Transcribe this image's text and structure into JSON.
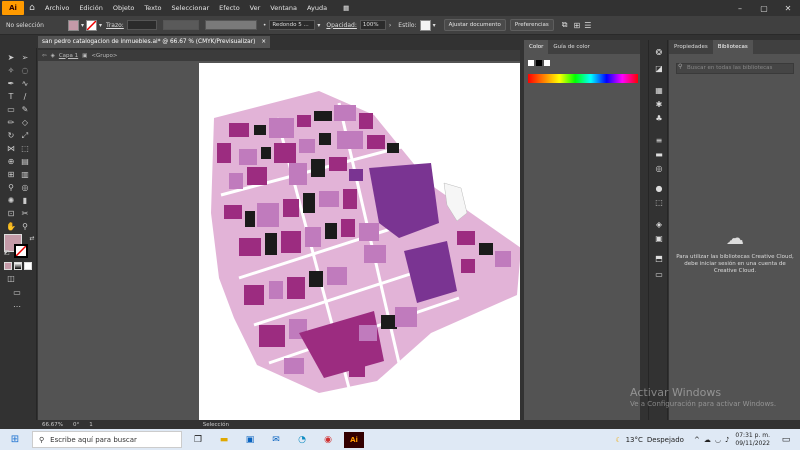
{
  "app": {
    "logo": "Ai",
    "menu": [
      "Archivo",
      "Edición",
      "Objeto",
      "Texto",
      "Seleccionar",
      "Efecto",
      "Ver",
      "Ventana",
      "Ayuda"
    ]
  },
  "control_bar": {
    "selection_label": "No selección",
    "stroke_label": "Trazo:",
    "brush": "Redondo 5 ...",
    "opacity_label": "Opacidad:",
    "opacity_value": "100%",
    "style_label": "Estilo:",
    "align_doc_button": "Ajustar documento",
    "prefs_button": "Preferencias"
  },
  "document": {
    "tab_title": "san pedro catalogacion de inmuebles.ai* @ 66.67 % (CMYK/Previsualizar)",
    "close_icon": "×",
    "breadcrumb_layer": "Capa 1",
    "breadcrumb_group": "<Grupo>"
  },
  "panels": {
    "color_tab": "Color",
    "color_guide_tab": "Guía de color",
    "properties_tab": "Propiedades",
    "libraries_tab": "Bibliotecas",
    "lib_search_placeholder": "Buscar en todas las bibliotecas",
    "lib_message": "Para utilizar las bibliotecas Creative Cloud, debe iniciar sesión en una cuenta de Creative Cloud."
  },
  "status": {
    "zoom": "66.67%",
    "rotation": "0°",
    "artboard": "1",
    "mode": "Selección"
  },
  "watermark": {
    "title": "Activar Windows",
    "subtitle": "Ve a Configuración para activar Windows."
  },
  "taskbar": {
    "search_placeholder": "Escribe aquí para buscar",
    "temperature": "13°C",
    "weather": "Despejado",
    "time": "07:31 p. m.",
    "date": "09/11/2022"
  },
  "colors": {
    "fill_swatch": "#c49aa8",
    "map_light": "#e2b3d7",
    "map_mid": "#c07bbd",
    "map_dark": "#9c2c80",
    "map_purple": "#7a3492",
    "map_black": "#1b1b1b"
  }
}
